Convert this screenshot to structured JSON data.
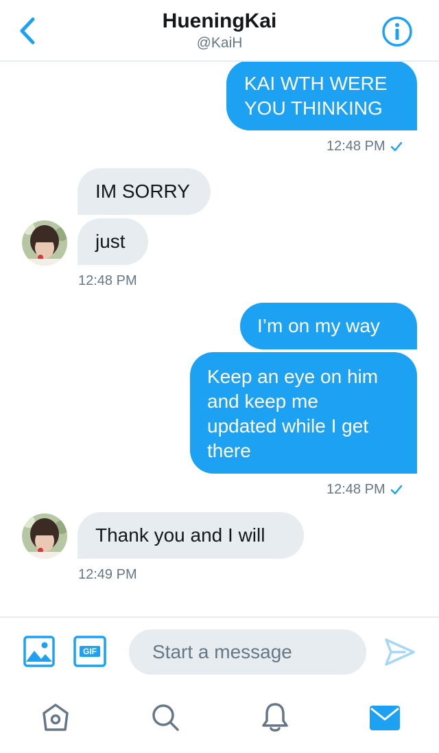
{
  "header": {
    "title": "HueningKai",
    "handle": "@KaiH"
  },
  "messages": [
    {
      "lines": [
        "KAI WTH WERE",
        "YOU THINKING"
      ],
      "time": "12:48 PM"
    },
    {
      "lines": [
        "IM SORRY"
      ]
    },
    {
      "lines": [
        "just"
      ],
      "time": "12:48 PM"
    },
    {
      "lines": [
        "I’m on my way"
      ]
    },
    {
      "lines": [
        "Keep an eye on him",
        "and keep me",
        "updated while I get",
        "there"
      ],
      "time": "12:48 PM"
    },
    {
      "lines": [
        "Thank you and I will"
      ],
      "time": "12:49 PM"
    }
  ],
  "composer": {
    "placeholder": "Start a message",
    "gif_label": "GIF"
  },
  "colors": {
    "accent": "#1da1f2",
    "incoming_bubble": "#e6ecf0",
    "secondary_text": "#657786"
  },
  "icons": [
    "back-chevron-icon",
    "info-icon",
    "image-icon",
    "gif-icon",
    "send-icon",
    "home-icon",
    "search-icon",
    "bell-icon",
    "mail-icon"
  ]
}
